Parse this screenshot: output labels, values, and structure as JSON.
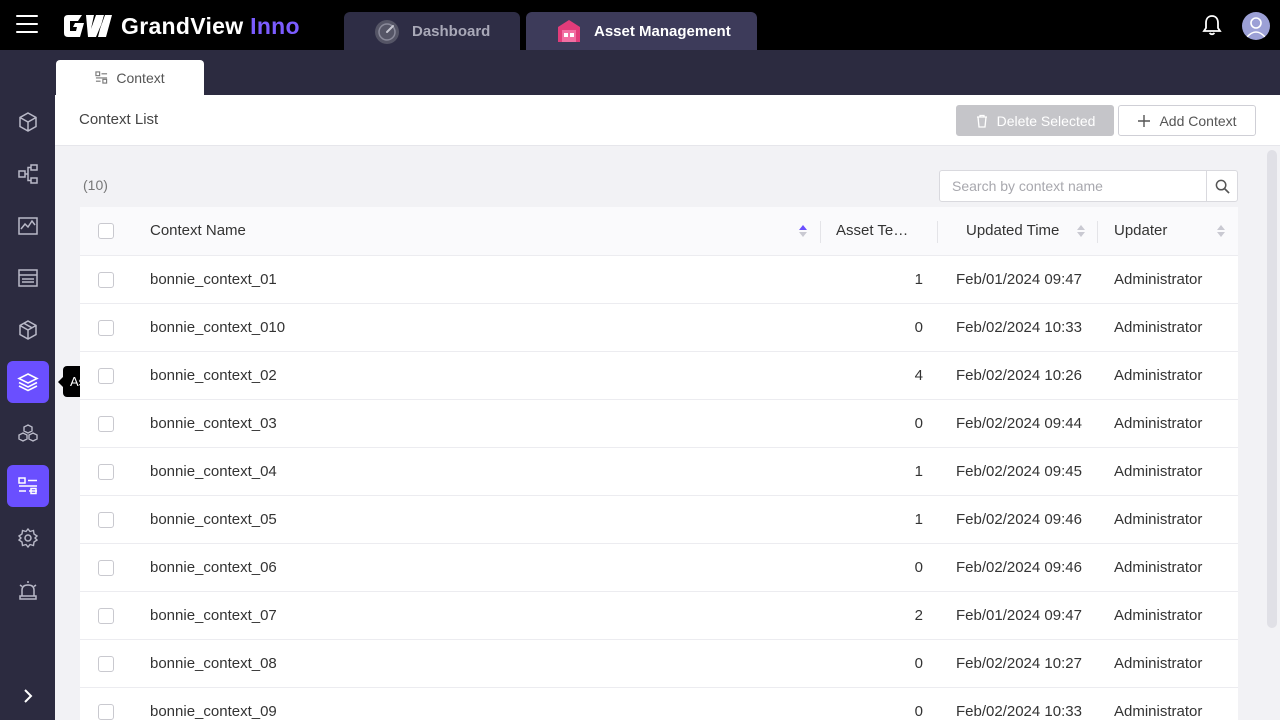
{
  "brand": {
    "name": "GrandView",
    "accent": "Inno"
  },
  "nav": {
    "tabs": [
      {
        "label": "Dashboard",
        "icon": "speedometer-icon"
      },
      {
        "label": "Asset Management",
        "icon": "warehouse-icon",
        "active": true
      }
    ]
  },
  "sidebar": {
    "items": [
      {
        "icon": "cube-icon"
      },
      {
        "icon": "hierarchy-icon"
      },
      {
        "icon": "chart-icon"
      },
      {
        "icon": "data-panel-icon"
      },
      {
        "icon": "package-icon"
      },
      {
        "icon": "layers-icon",
        "active": true,
        "tooltip": "Asset"
      },
      {
        "icon": "cubes-icon"
      },
      {
        "icon": "context-icon",
        "active": true
      },
      {
        "icon": "settings-icon"
      },
      {
        "icon": "alarm-icon"
      }
    ]
  },
  "context_tab": {
    "label": "Context"
  },
  "header": {
    "title": "Context List",
    "delete_label": "Delete Selected",
    "add_label": "Add Context"
  },
  "list": {
    "count": "(10)",
    "search_placeholder": "Search by context name",
    "columns": {
      "name": "Context Name",
      "asset": "Asset Templates",
      "time": "Updated Time",
      "updater": "Updater"
    },
    "rows": [
      {
        "name": "bonnie_context_01",
        "asset": "1",
        "time": "Feb/01/2024 09:47",
        "updater": "Administrator"
      },
      {
        "name": "bonnie_context_010",
        "asset": "0",
        "time": "Feb/02/2024 10:33",
        "updater": "Administrator"
      },
      {
        "name": "bonnie_context_02",
        "asset": "4",
        "time": "Feb/02/2024 10:26",
        "updater": "Administrator"
      },
      {
        "name": "bonnie_context_03",
        "asset": "0",
        "time": "Feb/02/2024 09:44",
        "updater": "Administrator"
      },
      {
        "name": "bonnie_context_04",
        "asset": "1",
        "time": "Feb/02/2024 09:45",
        "updater": "Administrator"
      },
      {
        "name": "bonnie_context_05",
        "asset": "1",
        "time": "Feb/02/2024 09:46",
        "updater": "Administrator"
      },
      {
        "name": "bonnie_context_06",
        "asset": "0",
        "time": "Feb/02/2024 09:46",
        "updater": "Administrator"
      },
      {
        "name": "bonnie_context_07",
        "asset": "2",
        "time": "Feb/01/2024 09:47",
        "updater": "Administrator"
      },
      {
        "name": "bonnie_context_08",
        "asset": "0",
        "time": "Feb/02/2024 10:27",
        "updater": "Administrator"
      },
      {
        "name": "bonnie_context_09",
        "asset": "0",
        "time": "Feb/02/2024 10:33",
        "updater": "Administrator"
      }
    ]
  },
  "colors": {
    "accent": "#6a4fff",
    "sidebar": "#2c2b40",
    "topbar": "#000000"
  }
}
